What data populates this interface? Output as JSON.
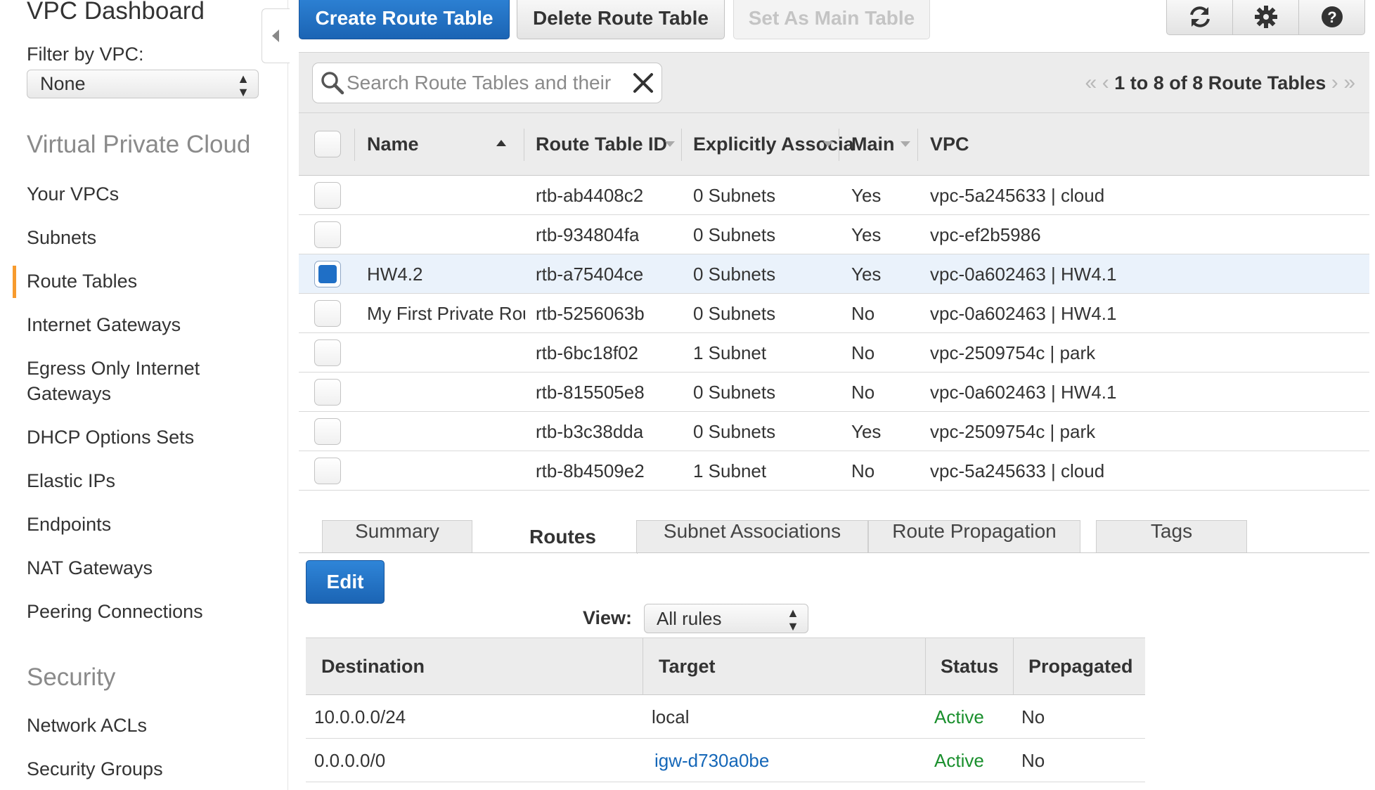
{
  "sidebar": {
    "dashboard_title": "VPC Dashboard",
    "filter_label": "Filter by VPC:",
    "filter_value": "None",
    "section_vpc": "Virtual Private Cloud",
    "vpc_items": [
      {
        "label": "Your VPCs"
      },
      {
        "label": "Subnets"
      },
      {
        "label": "Route Tables"
      },
      {
        "label": "Internet Gateways"
      },
      {
        "label": "Egress Only Internet"
      },
      {
        "label": "Gateways"
      },
      {
        "label": "DHCP Options Sets"
      },
      {
        "label": "Elastic IPs"
      },
      {
        "label": "Endpoints"
      },
      {
        "label": "NAT Gateways"
      },
      {
        "label": "Peering Connections"
      }
    ],
    "section_security": "Security",
    "security_items": [
      {
        "label": "Network ACLs"
      },
      {
        "label": "Security Groups"
      }
    ],
    "active_item": "Route Tables",
    "active_color": "#f79b2e"
  },
  "toolbar": {
    "create_label": "Create Route Table",
    "delete_label": "Delete Route Table",
    "set_main_label": "Set As Main Table",
    "icons": [
      "refresh-icon",
      "gear-icon",
      "help-icon"
    ]
  },
  "search": {
    "placeholder": "Search Route Tables and their",
    "pager_text": "1 to 8 of 8 Route Tables"
  },
  "route_tables": {
    "columns": [
      "Name",
      "Route Table ID",
      "Explicitly Associat",
      "Main",
      "VPC"
    ],
    "rows": [
      {
        "name": "",
        "id": "rtb-ab4408c2",
        "assoc": "0 Subnets",
        "main": "Yes",
        "vpc": "vpc-5a245633 | cloud",
        "selected": false
      },
      {
        "name": "",
        "id": "rtb-934804fa",
        "assoc": "0 Subnets",
        "main": "Yes",
        "vpc": "vpc-ef2b5986",
        "selected": false
      },
      {
        "name": "HW4.2",
        "id": "rtb-a75404ce",
        "assoc": "0 Subnets",
        "main": "Yes",
        "vpc": "vpc-0a602463 | HW4.1",
        "selected": true
      },
      {
        "name": "My First Private Route T",
        "id": "rtb-5256063b",
        "assoc": "0 Subnets",
        "main": "No",
        "vpc": "vpc-0a602463 | HW4.1",
        "selected": false
      },
      {
        "name": "",
        "id": "rtb-6bc18f02",
        "assoc": "1 Subnet",
        "main": "No",
        "vpc": "vpc-2509754c | park",
        "selected": false
      },
      {
        "name": "",
        "id": "rtb-815505e8",
        "assoc": "0 Subnets",
        "main": "No",
        "vpc": "vpc-0a602463 | HW4.1",
        "selected": false
      },
      {
        "name": "",
        "id": "rtb-b3c38dda",
        "assoc": "0 Subnets",
        "main": "Yes",
        "vpc": "vpc-2509754c | park",
        "selected": false
      },
      {
        "name": "",
        "id": "rtb-8b4509e2",
        "assoc": "1 Subnet",
        "main": "No",
        "vpc": "vpc-5a245633 | cloud",
        "selected": false
      }
    ]
  },
  "detail": {
    "tabs": [
      {
        "label": "Summary"
      },
      {
        "label": "Routes"
      },
      {
        "label": "Subnet Associations"
      },
      {
        "label": "Route Propagation"
      },
      {
        "label": "Tags"
      }
    ],
    "active_tab": "Routes",
    "edit_label": "Edit",
    "view_label": "View:",
    "view_value": "All rules",
    "routes_columns": [
      "Destination",
      "Target",
      "Status",
      "Propagated"
    ],
    "routes": [
      {
        "destination": "10.0.0.0/24",
        "target": "local",
        "status": "Active",
        "propagated": "No"
      },
      {
        "destination": "0.0.0.0/0",
        "target": "igw-d730a0be",
        "status": "Active",
        "propagated": "No"
      }
    ],
    "status_color": "#1a8f2d",
    "link_color": "#1567b8"
  }
}
